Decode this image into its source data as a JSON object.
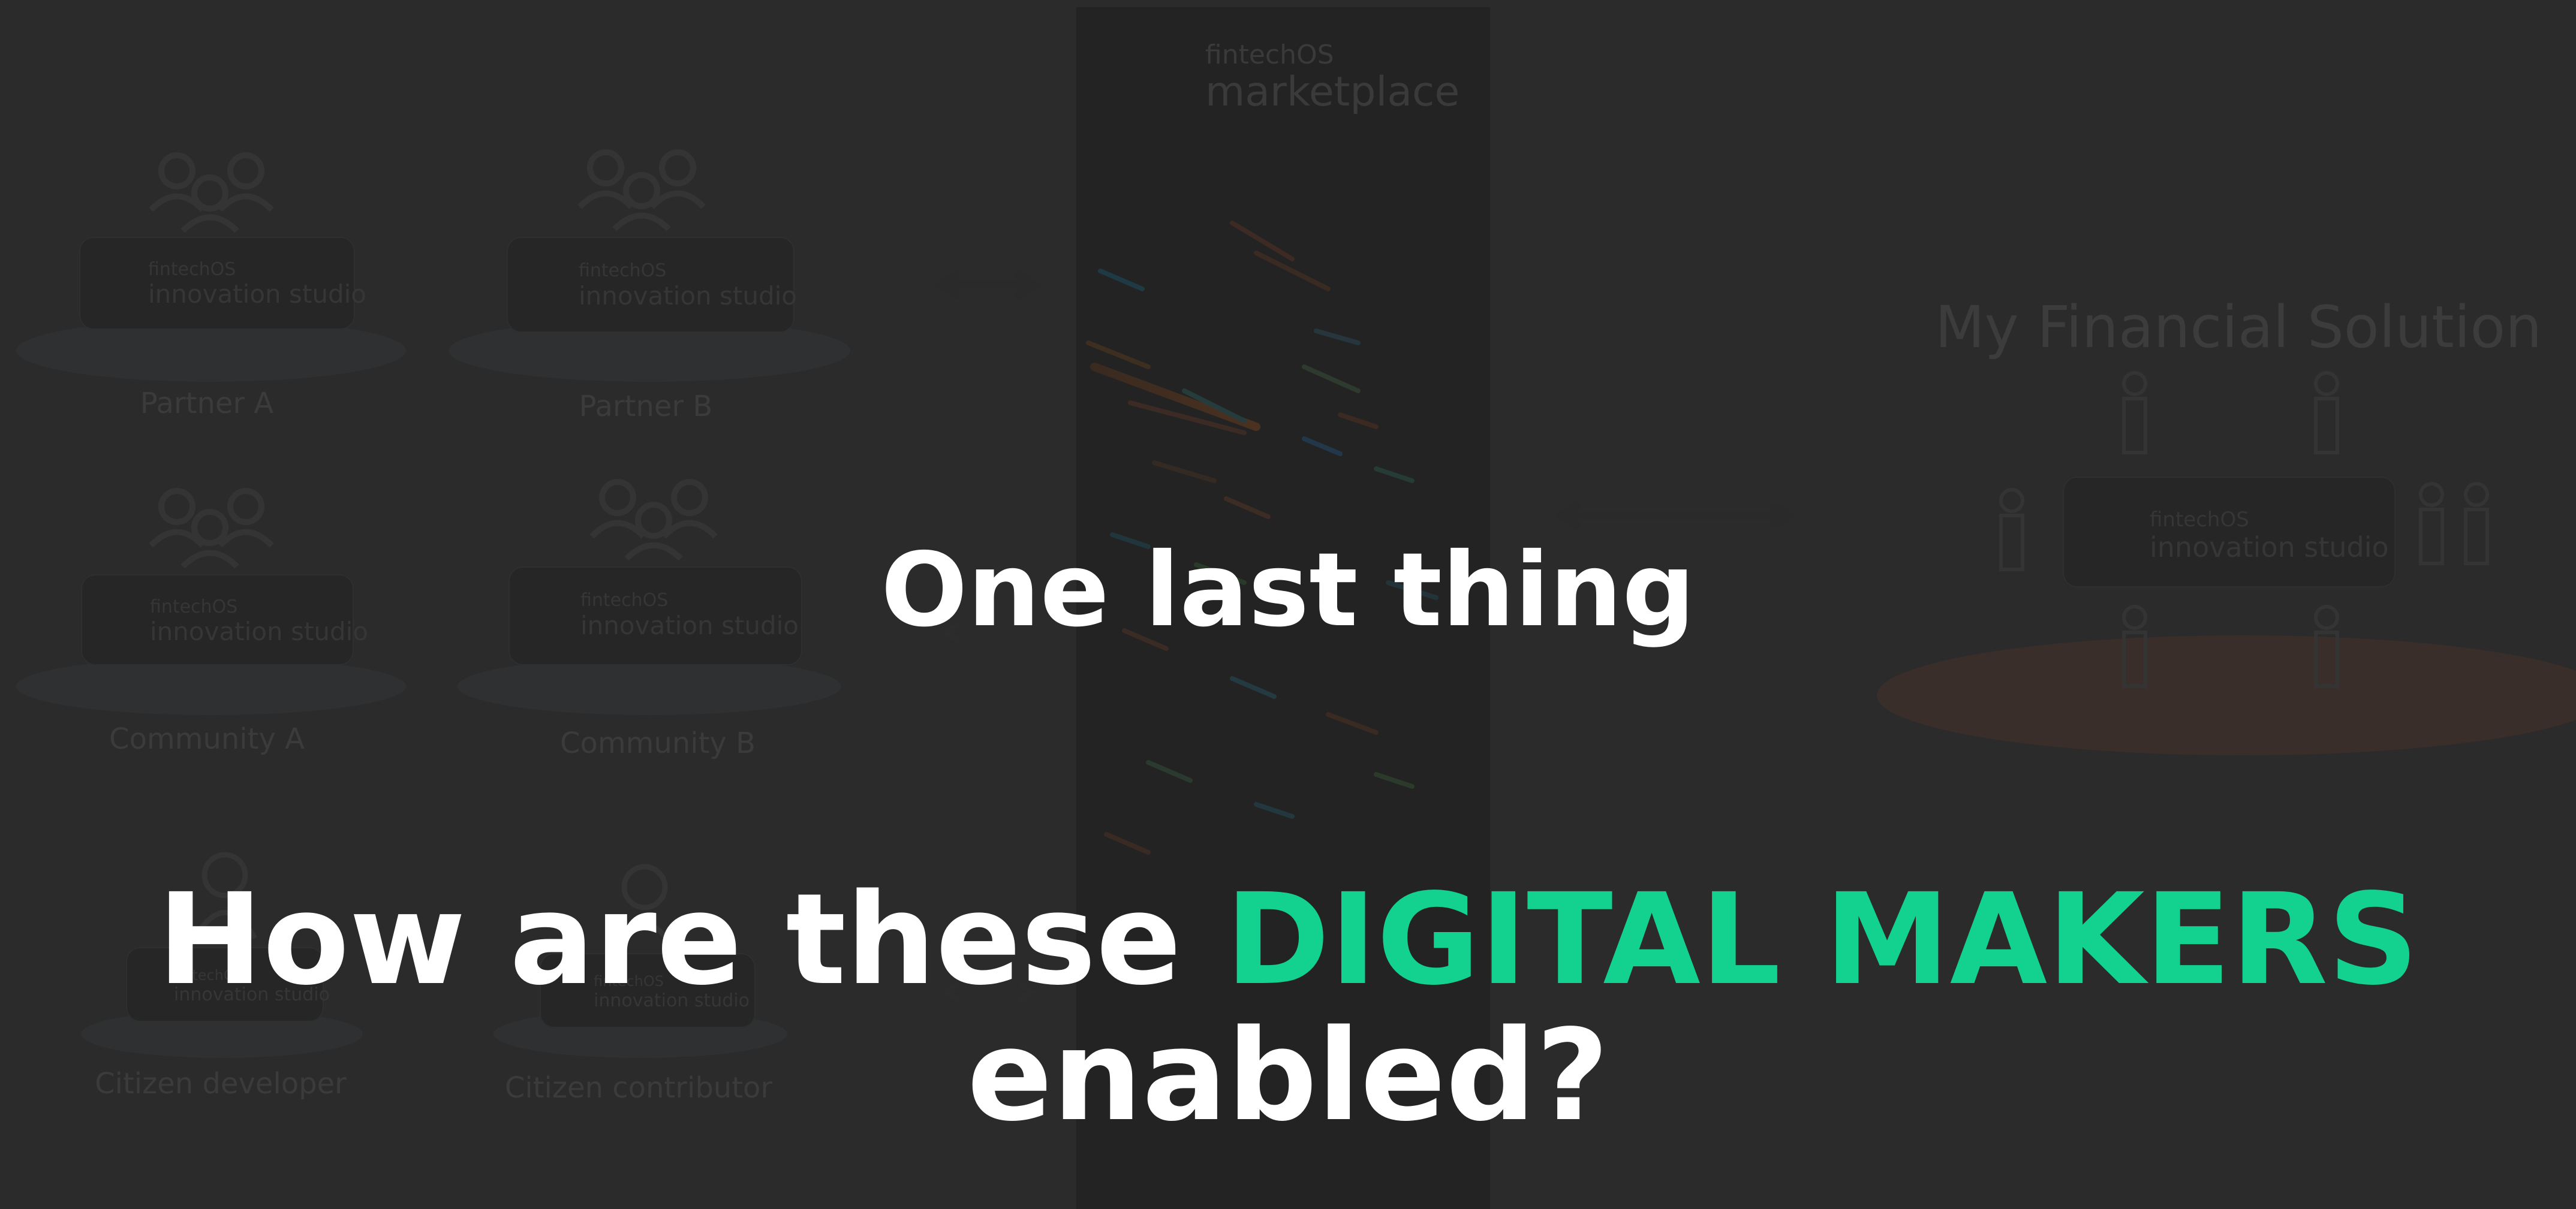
{
  "slide": {
    "heading_small": "One last thing",
    "question_prefix": "How are these",
    "question_highlight": "DIGITAL MAKERS",
    "question_suffix": "enabled?",
    "colors": {
      "background": "#2b2b2b",
      "text": "#ffffff",
      "highlight": "#13d18f"
    }
  },
  "background_diagram": {
    "marketplace": {
      "brand": "fintechOS",
      "name": "marketplace"
    },
    "studio": {
      "brand": "fintechOS",
      "name": "innovation studio"
    },
    "groups": [
      {
        "label": "Partner A"
      },
      {
        "label": "Partner B"
      },
      {
        "label": "Community A"
      },
      {
        "label": "Community B"
      },
      {
        "label": "Citizen developer"
      },
      {
        "label": "Citizen contributor"
      }
    ],
    "solution_title": "My Financial Solution"
  }
}
